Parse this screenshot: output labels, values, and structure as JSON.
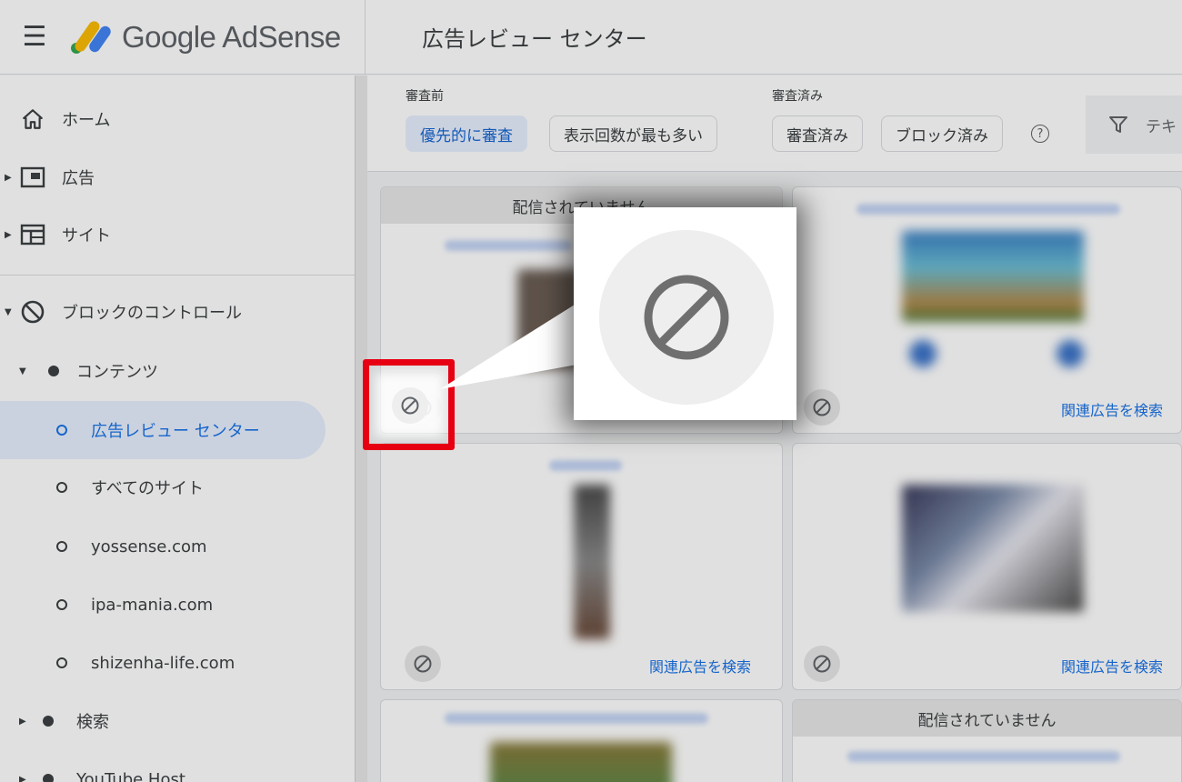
{
  "header": {
    "menu_icon": "menu-icon",
    "logo_text": "Google AdSense",
    "page_title": "広告レビュー センター"
  },
  "sidebar": {
    "home": "ホーム",
    "ads": "広告",
    "sites": "サイト",
    "blocking_controls": "ブロックのコントロール",
    "content": "コンテンツ",
    "ad_review_center": "広告レビュー センター",
    "all_sites": "すべてのサイト",
    "site1": "yossense.com",
    "site2": "ipa-mania.com",
    "site3": "shizenha-life.com",
    "search": "検索",
    "youtube_host": "YouTube Host"
  },
  "filters": {
    "before_review_label": "審査前",
    "reviewed_label": "審査済み",
    "priority_review": "優先的に審査",
    "most_impressions": "表示回数が最も多い",
    "reviewed": "審査済み",
    "blocked": "ブロック済み",
    "help": "?",
    "filter_partial": "テキ"
  },
  "cards": {
    "not_serving_1": "配信されていません",
    "not_serving_2": "配信されていません",
    "related_ads_1": "関連広告を検索",
    "related_ads_2": "関連広告を検索",
    "related_ads_3": "関連広告を検索"
  },
  "colors": {
    "accent": "#1a73e8",
    "highlight": "#e60012",
    "selected_bg": "#e8f0fe"
  }
}
